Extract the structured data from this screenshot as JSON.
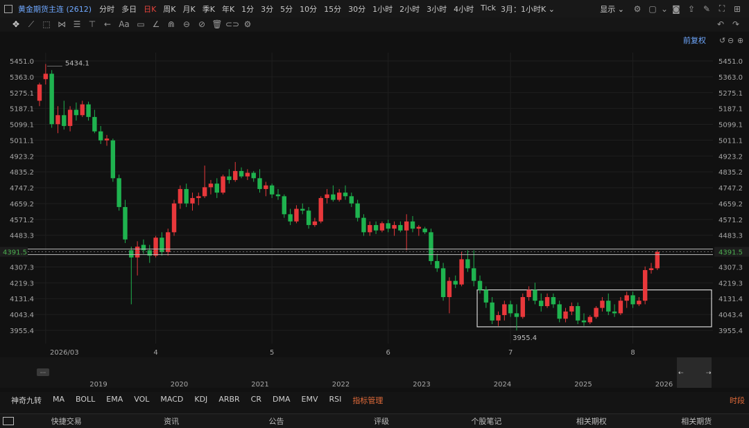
{
  "header": {
    "symbol": "黄金期货主连 (2612)",
    "periods": [
      "分时",
      "多日",
      "日K",
      "周K",
      "月K",
      "季K",
      "年K",
      "1分",
      "3分",
      "5分",
      "10分",
      "15分",
      "30分",
      "1小时",
      "2小时",
      "3小时",
      "4小时",
      "Tick"
    ],
    "active_period": "日K",
    "range_label": "3月：1小时K",
    "display_label": "显示"
  },
  "chart_toolbar": {
    "font_tool_label": "Aa",
    "adjust_label": "前复权"
  },
  "indicators": {
    "items": [
      "神奇九转",
      "MA",
      "BOLL",
      "EMA",
      "VOL",
      "MACD",
      "KDJ",
      "ARBR",
      "CR",
      "DMA",
      "EMV",
      "RSI",
      "指标管理"
    ],
    "highlighted": "指标管理",
    "right_label": "时段"
  },
  "bottom_tabs": [
    "快捷交易",
    "资讯",
    "公告",
    "评级",
    "个股笔记",
    "相关期权",
    "相关期货"
  ],
  "colors": {
    "up": "#e8383b",
    "down": "#1fb34f",
    "price_line": "#4caf50"
  },
  "chart_data": {
    "type": "candlestick",
    "y_ticks": [
      5451.0,
      5363.0,
      5275.1,
      5187.1,
      5099.1,
      5011.1,
      4923.2,
      4835.2,
      4747.2,
      4659.2,
      4571.2,
      4483.3,
      4307.3,
      4219.3,
      4131.4,
      4043.4,
      3955.4
    ],
    "current_price": "4391.5",
    "max_label": "5434.1",
    "min_label": "3955.4",
    "x_labels": [
      {
        "label": "2026/03",
        "i": 1
      },
      {
        "label": "4",
        "i": 19
      },
      {
        "label": "5",
        "i": 38
      },
      {
        "label": "6",
        "i": 57
      },
      {
        "label": "7",
        "i": 77
      },
      {
        "label": "8",
        "i": 97
      }
    ],
    "nav_years": [
      "2019",
      "2020",
      "2021",
      "2022",
      "2023",
      "2024",
      "2025",
      "2026"
    ],
    "range_box": {
      "from_i": 72,
      "to_i": 100,
      "high": 4180,
      "low": 3975
    },
    "candles": [
      {
        "o": 5230,
        "h": 5330,
        "l": 5200,
        "c": 5320
      },
      {
        "o": 5350,
        "h": 5434,
        "l": 5320,
        "c": 5380
      },
      {
        "o": 5380,
        "h": 5400,
        "l": 5080,
        "c": 5100
      },
      {
        "o": 5100,
        "h": 5200,
        "l": 5050,
        "c": 5150
      },
      {
        "o": 5150,
        "h": 5230,
        "l": 5070,
        "c": 5090
      },
      {
        "o": 5090,
        "h": 5200,
        "l": 5060,
        "c": 5180
      },
      {
        "o": 5180,
        "h": 5220,
        "l": 5120,
        "c": 5150
      },
      {
        "o": 5150,
        "h": 5230,
        "l": 5140,
        "c": 5210
      },
      {
        "o": 5210,
        "h": 5225,
        "l": 5120,
        "c": 5140
      },
      {
        "o": 5140,
        "h": 5180,
        "l": 5050,
        "c": 5060
      },
      {
        "o": 5060,
        "h": 5090,
        "l": 4990,
        "c": 5010
      },
      {
        "o": 5010,
        "h": 5040,
        "l": 4980,
        "c": 5020
      },
      {
        "o": 5010,
        "h": 5020,
        "l": 4780,
        "c": 4800
      },
      {
        "o": 4800,
        "h": 4820,
        "l": 4620,
        "c": 4640
      },
      {
        "o": 4640,
        "h": 4680,
        "l": 4440,
        "c": 4460
      },
      {
        "o": 4400,
        "h": 4420,
        "l": 4100,
        "c": 4360
      },
      {
        "o": 4360,
        "h": 4450,
        "l": 4260,
        "c": 4420
      },
      {
        "o": 4430,
        "h": 4460,
        "l": 4380,
        "c": 4400
      },
      {
        "o": 4400,
        "h": 4430,
        "l": 4330,
        "c": 4370
      },
      {
        "o": 4370,
        "h": 4480,
        "l": 4360,
        "c": 4470
      },
      {
        "o": 4470,
        "h": 4500,
        "l": 4370,
        "c": 4390
      },
      {
        "o": 4390,
        "h": 4520,
        "l": 4370,
        "c": 4500
      },
      {
        "o": 4500,
        "h": 4680,
        "l": 4480,
        "c": 4660
      },
      {
        "o": 4660,
        "h": 4760,
        "l": 4630,
        "c": 4740
      },
      {
        "o": 4740,
        "h": 4770,
        "l": 4640,
        "c": 4660
      },
      {
        "o": 4660,
        "h": 4720,
        "l": 4620,
        "c": 4690
      },
      {
        "o": 4690,
        "h": 4720,
        "l": 4650,
        "c": 4700
      },
      {
        "o": 4700,
        "h": 4870,
        "l": 4690,
        "c": 4750
      },
      {
        "o": 4750,
        "h": 4790,
        "l": 4710,
        "c": 4770
      },
      {
        "o": 4770,
        "h": 4800,
        "l": 4690,
        "c": 4720
      },
      {
        "o": 4720,
        "h": 4820,
        "l": 4710,
        "c": 4810
      },
      {
        "o": 4810,
        "h": 4850,
        "l": 4770,
        "c": 4790
      },
      {
        "o": 4790,
        "h": 4890,
        "l": 4780,
        "c": 4840
      },
      {
        "o": 4840,
        "h": 4860,
        "l": 4800,
        "c": 4810
      },
      {
        "o": 4810,
        "h": 4850,
        "l": 4790,
        "c": 4830
      },
      {
        "o": 4830,
        "h": 4840,
        "l": 4780,
        "c": 4800
      },
      {
        "o": 4800,
        "h": 4850,
        "l": 4720,
        "c": 4740
      },
      {
        "o": 4740,
        "h": 4780,
        "l": 4700,
        "c": 4760
      },
      {
        "o": 4760,
        "h": 4770,
        "l": 4690,
        "c": 4710
      },
      {
        "o": 4710,
        "h": 4740,
        "l": 4680,
        "c": 4700
      },
      {
        "o": 4700,
        "h": 4710,
        "l": 4580,
        "c": 4600
      },
      {
        "o": 4600,
        "h": 4630,
        "l": 4540,
        "c": 4560
      },
      {
        "o": 4560,
        "h": 4650,
        "l": 4550,
        "c": 4630
      },
      {
        "o": 4630,
        "h": 4660,
        "l": 4600,
        "c": 4620
      },
      {
        "o": 4620,
        "h": 4640,
        "l": 4520,
        "c": 4540
      },
      {
        "o": 4540,
        "h": 4580,
        "l": 4530,
        "c": 4560
      },
      {
        "o": 4560,
        "h": 4700,
        "l": 4550,
        "c": 4690
      },
      {
        "o": 4690,
        "h": 4740,
        "l": 4660,
        "c": 4710
      },
      {
        "o": 4710,
        "h": 4760,
        "l": 4670,
        "c": 4680
      },
      {
        "o": 4680,
        "h": 4740,
        "l": 4670,
        "c": 4720
      },
      {
        "o": 4720,
        "h": 4760,
        "l": 4680,
        "c": 4700
      },
      {
        "o": 4700,
        "h": 4720,
        "l": 4640,
        "c": 4660
      },
      {
        "o": 4660,
        "h": 4680,
        "l": 4560,
        "c": 4580
      },
      {
        "o": 4580,
        "h": 4600,
        "l": 4480,
        "c": 4500
      },
      {
        "o": 4500,
        "h": 4560,
        "l": 4480,
        "c": 4540
      },
      {
        "o": 4540,
        "h": 4560,
        "l": 4490,
        "c": 4510
      },
      {
        "o": 4510,
        "h": 4560,
        "l": 4500,
        "c": 4550
      },
      {
        "o": 4550,
        "h": 4570,
        "l": 4500,
        "c": 4520
      },
      {
        "o": 4520,
        "h": 4560,
        "l": 4480,
        "c": 4540
      },
      {
        "o": 4540,
        "h": 4560,
        "l": 4500,
        "c": 4510
      },
      {
        "o": 4510,
        "h": 4600,
        "l": 4400,
        "c": 4560
      },
      {
        "o": 4560,
        "h": 4590,
        "l": 4500,
        "c": 4520
      },
      {
        "o": 4520,
        "h": 4540,
        "l": 4480,
        "c": 4530
      },
      {
        "o": 4520,
        "h": 4530,
        "l": 4490,
        "c": 4500
      },
      {
        "o": 4500,
        "h": 4520,
        "l": 4320,
        "c": 4340
      },
      {
        "o": 4340,
        "h": 4380,
        "l": 4280,
        "c": 4300
      },
      {
        "o": 4300,
        "h": 4330,
        "l": 4120,
        "c": 4140
      },
      {
        "o": 4140,
        "h": 4250,
        "l": 4050,
        "c": 4230
      },
      {
        "o": 4230,
        "h": 4260,
        "l": 4190,
        "c": 4210
      },
      {
        "o": 4210,
        "h": 4390,
        "l": 4200,
        "c": 4350
      },
      {
        "o": 4350,
        "h": 4400,
        "l": 4280,
        "c": 4300
      },
      {
        "o": 4300,
        "h": 4400,
        "l": 4200,
        "c": 4230
      },
      {
        "o": 4230,
        "h": 4260,
        "l": 4160,
        "c": 4180
      },
      {
        "o": 4180,
        "h": 4200,
        "l": 4080,
        "c": 4110
      },
      {
        "o": 4110,
        "h": 4140,
        "l": 3990,
        "c": 4010
      },
      {
        "o": 4010,
        "h": 4060,
        "l": 3980,
        "c": 4040
      },
      {
        "o": 4040,
        "h": 4120,
        "l": 4010,
        "c": 4100
      },
      {
        "o": 4100,
        "h": 4120,
        "l": 4030,
        "c": 4050
      },
      {
        "o": 4050,
        "h": 4100,
        "l": 3955,
        "c": 4030
      },
      {
        "o": 4030,
        "h": 4160,
        "l": 4020,
        "c": 4140
      },
      {
        "o": 4140,
        "h": 4200,
        "l": 4120,
        "c": 4180
      },
      {
        "o": 4180,
        "h": 4220,
        "l": 4100,
        "c": 4120
      },
      {
        "o": 4120,
        "h": 4160,
        "l": 4060,
        "c": 4090
      },
      {
        "o": 4090,
        "h": 4160,
        "l": 4080,
        "c": 4140
      },
      {
        "o": 4140,
        "h": 4160,
        "l": 4080,
        "c": 4100
      },
      {
        "o": 4100,
        "h": 4120,
        "l": 4000,
        "c": 4020
      },
      {
        "o": 4020,
        "h": 4080,
        "l": 4000,
        "c": 4060
      },
      {
        "o": 4060,
        "h": 4110,
        "l": 4040,
        "c": 4090
      },
      {
        "o": 4090,
        "h": 4110,
        "l": 3990,
        "c": 4010
      },
      {
        "o": 4010,
        "h": 4050,
        "l": 3980,
        "c": 4000
      },
      {
        "o": 4000,
        "h": 4040,
        "l": 3990,
        "c": 4030
      },
      {
        "o": 4030,
        "h": 4090,
        "l": 4020,
        "c": 4080
      },
      {
        "o": 4080,
        "h": 4140,
        "l": 4060,
        "c": 4120
      },
      {
        "o": 4120,
        "h": 4160,
        "l": 4040,
        "c": 4060
      },
      {
        "o": 4060,
        "h": 4100,
        "l": 4030,
        "c": 4050
      },
      {
        "o": 4050,
        "h": 4140,
        "l": 4040,
        "c": 4120
      },
      {
        "o": 4120,
        "h": 4170,
        "l": 4080,
        "c": 4150
      },
      {
        "o": 4150,
        "h": 4170,
        "l": 4080,
        "c": 4100
      },
      {
        "o": 4100,
        "h": 4140,
        "l": 4090,
        "c": 4120
      },
      {
        "o": 4120,
        "h": 4310,
        "l": 4100,
        "c": 4290
      },
      {
        "o": 4290,
        "h": 4330,
        "l": 4270,
        "c": 4300
      },
      {
        "o": 4300,
        "h": 4400,
        "l": 4290,
        "c": 4391
      }
    ]
  }
}
